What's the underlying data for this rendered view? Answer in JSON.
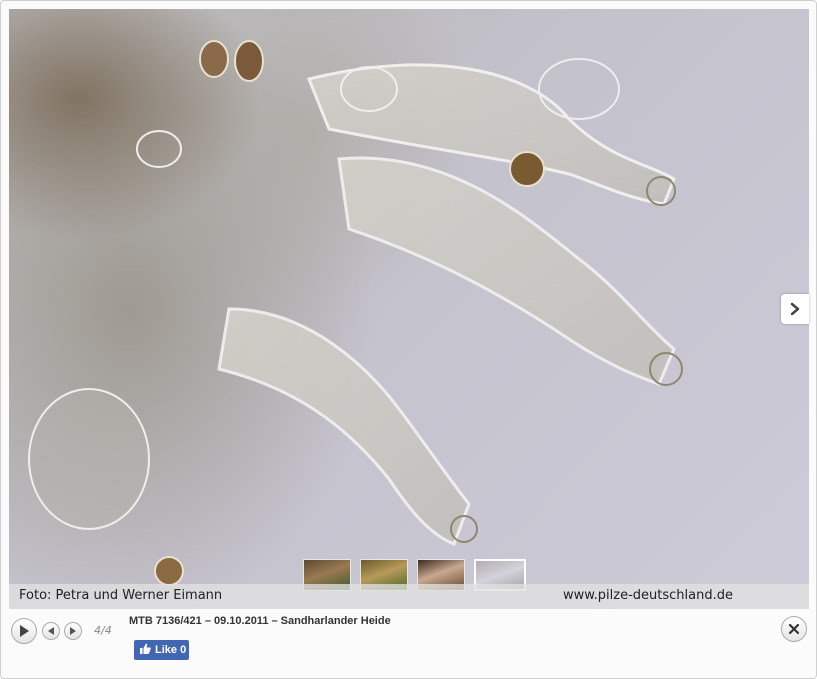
{
  "photo": {
    "credit": "Foto: Petra und Werner Eimann",
    "site": "www.pilze-deutschland.de"
  },
  "gallery": {
    "counter": "4/4",
    "title": "MTB 7136/421 – 09.10.2011 – Sandharlander Heide",
    "thumbnails": [
      "mushroom-photo-1",
      "mushroom-photo-2",
      "mushroom-photo-3",
      "microscopy-photo-4"
    ]
  },
  "social": {
    "like_label": "Like 0"
  },
  "icons": {
    "play": "play-icon",
    "prev": "arrow-left-icon",
    "next": "arrow-right-icon",
    "close": "close-icon",
    "next_slide": "chevron-right-icon",
    "like": "thumbs-up-icon"
  },
  "colors": {
    "facebook": "#4267b2",
    "caption_bar": "#e1e1e1"
  }
}
